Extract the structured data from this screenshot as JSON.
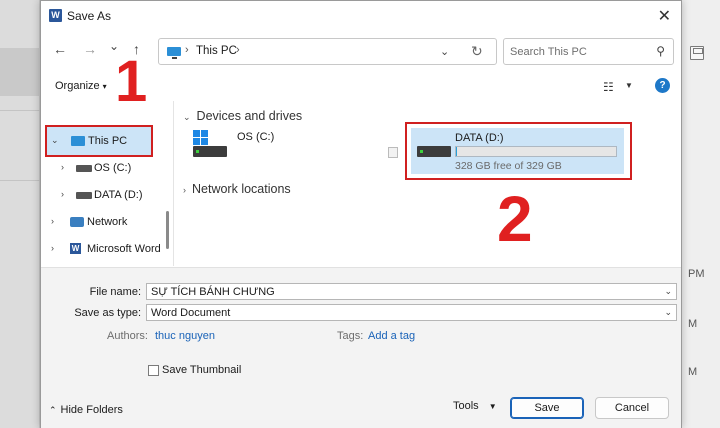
{
  "window": {
    "title": "Save As",
    "app_icon": "word-icon",
    "close_glyph": "✕"
  },
  "annotations": {
    "step1": "1",
    "step2": "2",
    "color": "#e02020"
  },
  "nav": {
    "back": "←",
    "forward": "→",
    "recent": "⌄",
    "up": "↑",
    "address": "This PC",
    "address_sep": "›",
    "search_placeholder": "Search This PC"
  },
  "toolbar": {
    "organize": "Organize",
    "organize_caret": "▾",
    "help": "?"
  },
  "tree": [
    {
      "label": "This PC",
      "icon": "pc-icon",
      "chevron": "⌄",
      "selected": true
    },
    {
      "label": "OS (C:)",
      "icon": "drive-icon",
      "chevron": "›"
    },
    {
      "label": "DATA (D:)",
      "icon": "drive-icon",
      "chevron": "›"
    },
    {
      "label": "Network",
      "icon": "network-icon",
      "chevron": "›"
    },
    {
      "label": "Microsoft Word",
      "icon": "word-icon",
      "chevron": "›"
    }
  ],
  "content": {
    "devices_header": "Devices and drives",
    "network_header": "Network locations",
    "drives": [
      {
        "name": "OS (C:)"
      },
      {
        "name": "DATA (D:)",
        "free_text": "328 GB free of 329 GB",
        "used_fraction": 0.003,
        "selected": true
      }
    ]
  },
  "form": {
    "file_name_label": "File name:",
    "file_name_value": "SỰ TÍCH BÁNH CHƯNG",
    "save_type_label": "Save as type:",
    "save_type_value": "Word Document",
    "authors_label": "Authors:",
    "authors_value": "thuc nguyen",
    "tags_label": "Tags:",
    "tags_value": "Add a tag",
    "thumbnail_label": "Save Thumbnail",
    "hide_folders": "Hide Folders",
    "tools": "Tools",
    "save": "Save",
    "cancel": "Cancel"
  },
  "background": {
    "right_fragments": [
      "PM",
      "M",
      "M"
    ]
  }
}
